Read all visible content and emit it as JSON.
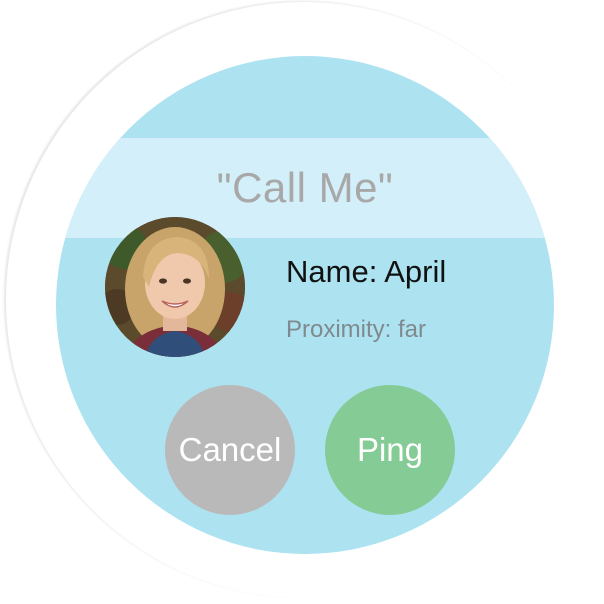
{
  "screen": {
    "title": "\"Call Me\""
  },
  "contact": {
    "avatar_icon": "person-photo",
    "name_label": "Name: April",
    "proximity_label": "Proximity: far"
  },
  "actions": {
    "cancel_label": "Cancel",
    "ping_label": "Ping"
  },
  "colors": {
    "face_background": "#ade2f1",
    "title_band": "#d3eff9",
    "cancel_button": "#b9b9b9",
    "ping_button": "#84cb95"
  }
}
